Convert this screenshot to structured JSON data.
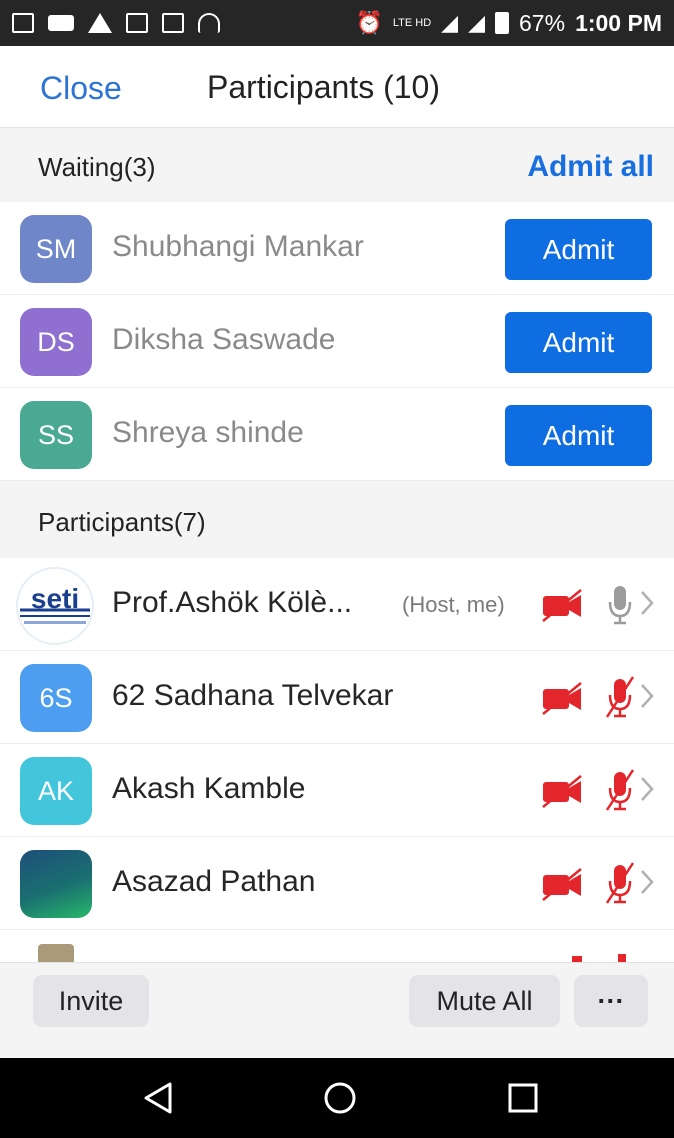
{
  "status_bar": {
    "battery": "67%",
    "time": "1:00 PM",
    "network": "LTE HD",
    "icons": [
      "notification-icon",
      "video-icon",
      "warning-icon",
      "gallery-icon",
      "image-icon",
      "headset-icon",
      "alarm-icon",
      "signal-icon",
      "battery-icon"
    ]
  },
  "header": {
    "close_label": "Close",
    "title": "Participants (10)"
  },
  "waiting": {
    "label": "Waiting(3)",
    "admit_all_label": "Admit all",
    "admit_label": "Admit",
    "items": [
      {
        "initials": "SM",
        "name": "Shubhangi Mankar",
        "color": "#6f86c9"
      },
      {
        "initials": "DS",
        "name": "Diksha Saswade",
        "color": "#8f6fd0"
      },
      {
        "initials": "SS",
        "name": "Shreya shinde",
        "color": "#4aa993"
      }
    ]
  },
  "participants": {
    "label": "Participants(7)",
    "items": [
      {
        "initials": "",
        "logo_text": "seti",
        "name": "Prof.Ashök Kölè...",
        "role": "(Host, me)",
        "video": "off",
        "audio": "unmuted"
      },
      {
        "initials": "6S",
        "name": "62 Sadhana Telvekar",
        "color": "#4d9df0",
        "video": "off",
        "audio": "muted"
      },
      {
        "initials": "AK",
        "name": "Akash Kamble",
        "color": "#43c5dc",
        "video": "off",
        "audio": "muted"
      },
      {
        "initials": "",
        "name": "Asazad Pathan",
        "video": "off",
        "audio": "muted"
      }
    ]
  },
  "bottom_bar": {
    "invite_label": "Invite",
    "mute_all_label": "Mute All",
    "more_label": "···"
  },
  "nav_bar": {
    "back": "back-icon",
    "home": "home-icon",
    "recents": "recents-icon"
  },
  "colors": {
    "accent": "#2e74d5",
    "admit_button": "#0e6de0",
    "muted_red": "#e3262b"
  }
}
